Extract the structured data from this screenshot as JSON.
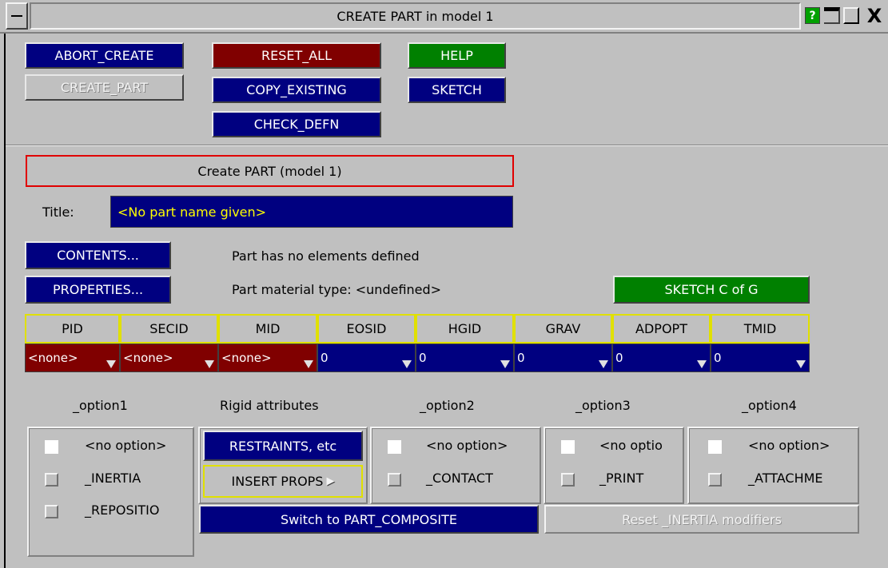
{
  "window": {
    "title": "CREATE PART in model 1",
    "help_glyph": "?",
    "close_glyph": "X"
  },
  "toolbar": {
    "abort_create": "ABORT_CREATE",
    "create_part": "CREATE_PART",
    "reset_all": "RESET_ALL",
    "copy_existing": "COPY_EXISTING",
    "check_defn": "CHECK_DEFN",
    "help": "HELP",
    "sketch": "SKETCH"
  },
  "part": {
    "header": "Create PART (model 1)",
    "title_label": "Title:",
    "title_value": "<No part name given>",
    "contents_button": "CONTENTS...",
    "contents_status": "Part has no elements defined",
    "properties_button": "PROPERTIES...",
    "material_status": "Part material type: <undefined>",
    "sketch_cog_button": "SKETCH C of G"
  },
  "fields": [
    {
      "header": "PID",
      "value": "<none>",
      "state": "red"
    },
    {
      "header": "SECID",
      "value": "<none>",
      "state": "red"
    },
    {
      "header": "MID",
      "value": "<none>",
      "state": "red"
    },
    {
      "header": "EOSID",
      "value": "0",
      "state": "blue"
    },
    {
      "header": "HGID",
      "value": "0",
      "state": "blue"
    },
    {
      "header": "GRAV",
      "value": "0",
      "state": "blue"
    },
    {
      "header": "ADPOPT",
      "value": "0",
      "state": "blue"
    },
    {
      "header": "TMID",
      "value": "0",
      "state": "blue"
    }
  ],
  "options": {
    "option1": {
      "heading": "_option1",
      "items": [
        {
          "label": "<no option>",
          "checked": true
        },
        {
          "label": "_INERTIA",
          "checked": false
        },
        {
          "label": "_REPOSITIO",
          "checked": false
        }
      ]
    },
    "rigid": {
      "heading": "Rigid attributes",
      "restraints_button": "RESTRAINTS, etc",
      "insert_props_button": "INSERT PROPS",
      "insert_props_glyph": "▶"
    },
    "option2": {
      "heading": "_option2",
      "items": [
        {
          "label": "<no option>",
          "checked": true
        },
        {
          "label": "_CONTACT",
          "checked": false
        }
      ]
    },
    "option3": {
      "heading": "_option3",
      "items": [
        {
          "label": "<no optio",
          "checked": true
        },
        {
          "label": "_PRINT",
          "checked": false
        }
      ]
    },
    "option4": {
      "heading": "_option4",
      "items": [
        {
          "label": "<no option>",
          "checked": true
        },
        {
          "label": "_ATTACHME",
          "checked": false
        }
      ]
    }
  },
  "bottom": {
    "switch_composite": "Switch to PART_COMPOSITE",
    "reset_inertia": "Reset _INERTIA modifiers"
  },
  "colors": {
    "button_blue": "#000080",
    "button_red": "#800000",
    "button_green": "#008000",
    "highlight_yellow": "#e0e000",
    "title_text_yellow": "#ffff00",
    "header_box_red": "#e00000"
  }
}
